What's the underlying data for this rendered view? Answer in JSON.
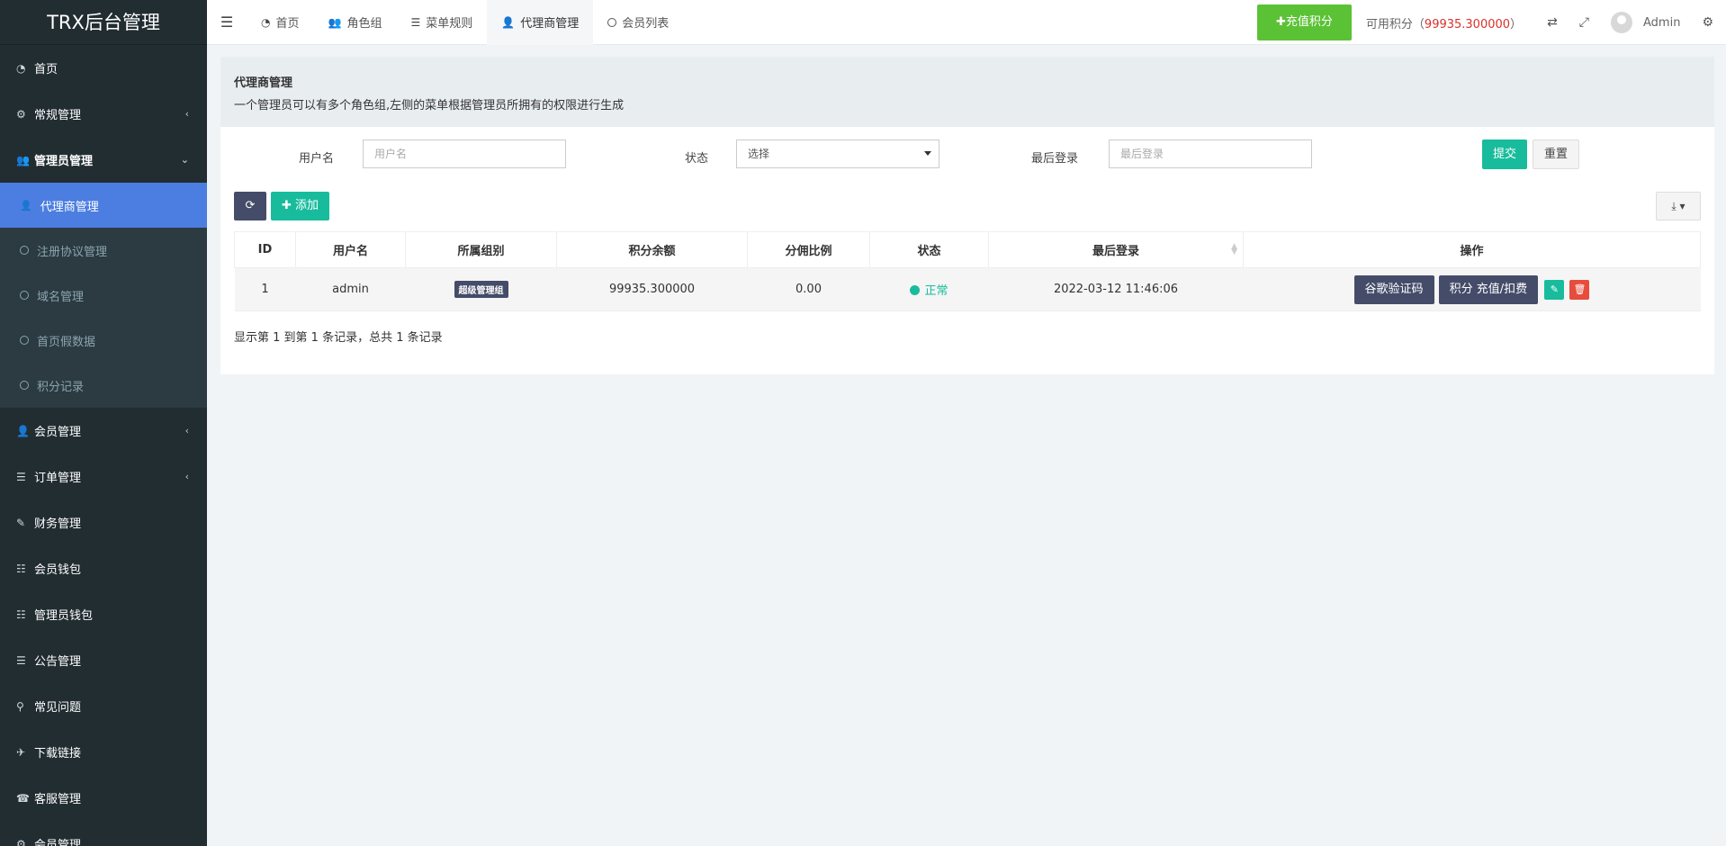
{
  "sidebar": {
    "logo": "TRX后台管理",
    "items": [
      {
        "label": "首页",
        "icon": "dashboard-icon",
        "glyph": "◔"
      },
      {
        "label": "常规管理",
        "icon": "cogs-icon",
        "glyph": "⚙",
        "chevron": "‹"
      },
      {
        "label": "管理员管理",
        "icon": "group-icon",
        "glyph": "👥",
        "chevron": "⌄"
      }
    ],
    "submenu": [
      {
        "label": "代理商管理",
        "active": true
      },
      {
        "label": "注册协议管理"
      },
      {
        "label": "域名管理"
      },
      {
        "label": "首页假数据"
      },
      {
        "label": "积分记录"
      }
    ],
    "items2": [
      {
        "label": "会员管理",
        "glyph": "👤",
        "chevron": "‹"
      },
      {
        "label": "订单管理",
        "glyph": "☰",
        "chevron": "‹"
      },
      {
        "label": "财务管理",
        "glyph": "✎"
      },
      {
        "label": "会员钱包",
        "glyph": "☷"
      },
      {
        "label": "管理员钱包",
        "glyph": "☷"
      },
      {
        "label": "公告管理",
        "glyph": "☰"
      },
      {
        "label": "常见问题",
        "glyph": "⚲"
      },
      {
        "label": "下载链接",
        "glyph": "✈"
      },
      {
        "label": "客服管理",
        "glyph": "☎"
      },
      {
        "label": "会员管理",
        "glyph": "⚙"
      }
    ]
  },
  "topbar": {
    "tabs": [
      {
        "label": "首页",
        "glyph": "◔"
      },
      {
        "label": "角色组",
        "glyph": "👥"
      },
      {
        "label": "菜单规则",
        "glyph": "☰"
      },
      {
        "label": "代理商管理",
        "glyph": "👤",
        "active": true
      },
      {
        "label": "会员列表",
        "circle": true
      }
    ],
    "recharge_label": "✚充值积分",
    "credits_prefix": "可用积分（",
    "credits_amount": "99935.300000",
    "credits_suffix": "）",
    "user": "Admin"
  },
  "panel": {
    "title": "代理商管理",
    "description": "一个管理员可以有多个角色组,左侧的菜单根据管理员所拥有的权限进行生成"
  },
  "filter": {
    "username_label": "用户名",
    "username_placeholder": "用户名",
    "status_label": "状态",
    "status_value": "选择",
    "lastlogin_label": "最后登录",
    "lastlogin_placeholder": "最后登录",
    "submit": "提交",
    "reset": "重置"
  },
  "toolbar": {
    "add": "✚ 添加"
  },
  "table": {
    "columns": [
      "ID",
      "用户名",
      "所属组别",
      "积分余额",
      "分佣比例",
      "状态",
      "最后登录",
      "操作"
    ],
    "rows": [
      {
        "id": "1",
        "username": "admin",
        "group": "超级管理组",
        "balance": "99935.300000",
        "ratio": "0.00",
        "status": "正常",
        "last_login": "2022-03-12 11:46:06",
        "actions": [
          "谷歌验证码",
          "积分 充值/扣费"
        ]
      }
    ]
  },
  "summary": "显示第 1 到第 1 条记录，总共 1 条记录",
  "colors": {
    "sidebar_bg": "#222d32",
    "active_blue": "#4b7ee0",
    "success": "#18bc9c",
    "recharge_green": "#5bc236",
    "dark_button": "#444c69",
    "danger": "#e74c3c"
  }
}
